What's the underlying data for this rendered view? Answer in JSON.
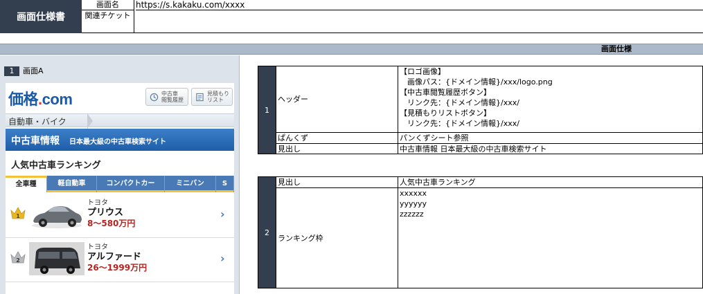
{
  "document": {
    "title": "画面仕様書",
    "label_screen_name": "画面名",
    "value_screen_name": "https://s.kakaku.com/xxxx",
    "label_ticket": "関連チケット",
    "value_ticket": ""
  },
  "section": {
    "title": "画面仕様"
  },
  "screen": {
    "number": "1",
    "name": "画面A",
    "mock": {
      "logo_main": "価格",
      "logo_dot": ".",
      "logo_com": "com",
      "btn_history": "中古車\n閲覧履歴",
      "btn_estimate": "見積もり\nリスト",
      "breadcrumb": "自動車・バイク",
      "heading_main": "中古車情報",
      "heading_sub": "日本最大級の中古車検索サイト",
      "ranking_title": "人気中古車ランキング",
      "tabs": [
        "全車種",
        "軽自動車",
        "コンパクトカー",
        "ミニバン",
        "S"
      ],
      "rankings": [
        {
          "rank": "1",
          "maker": "トヨタ",
          "model": "プリウス",
          "price": "8～580万円",
          "crown_color": "#e8b923"
        },
        {
          "rank": "2",
          "maker": "トヨタ",
          "model": "アルファード",
          "price": "26～1999万円",
          "crown_color": "#a7a9ac"
        }
      ]
    }
  },
  "spec1": {
    "number": "1",
    "rows": [
      {
        "label": "ヘッダー",
        "value": "【ロゴ画像】\n　画像パス：{ドメイン情報}/xxx/logo.png\n【中古車閲覧履歴ボタン】\n　リンク先：{ドメイン情報}/xxx/\n【見積もりリストボタン】\n　リンク先：{ドメイン情報}/xxx/"
      },
      {
        "label": "ぱんくず",
        "value": "パンくずシート参照"
      },
      {
        "label": "見出し",
        "value": "中古車情報 日本最大級の中古車検索サイト"
      }
    ]
  },
  "spec2": {
    "number": "2",
    "rows": [
      {
        "label": "見出し",
        "value": "人気中古車ランキング"
      },
      {
        "label": "ランキング枠",
        "value": "xxxxxx\nyyyyyy\nzzzzzz"
      }
    ]
  }
}
